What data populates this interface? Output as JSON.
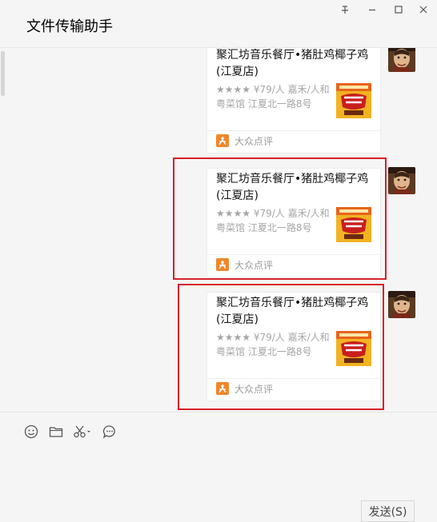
{
  "window": {
    "title": "文件传输助手",
    "controls": [
      "pin-icon",
      "minimize-icon",
      "maximize-icon",
      "close-icon"
    ]
  },
  "messages": [
    {
      "title": "聚汇坊音乐餐厅•猪肚鸡椰子鸡(江夏店)",
      "rating_stars": "★★★★",
      "desc": " ¥79/人 嘉禾/人和 粤菜馆 江夏北一路8号",
      "source": "大众点评",
      "highlighted": false
    },
    {
      "title": "聚汇坊音乐餐厅•猪肚鸡椰子鸡(江夏店)",
      "rating_stars": "★★★★",
      "desc": " ¥79/人 嘉禾/人和 粤菜馆 江夏北一路8号",
      "source": "大众点评",
      "highlighted": true
    },
    {
      "title": "聚汇坊音乐餐厅•猪肚鸡椰子鸡(江夏店)",
      "rating_stars": "★★★★",
      "desc": " ¥79/人 嘉禾/人和 粤菜馆 江夏北一路8号",
      "source": "大众点评",
      "highlighted": true
    }
  ],
  "toolbar": {
    "icons": [
      "emoji-icon",
      "folder-icon",
      "scissors-icon",
      "chat-history-icon"
    ]
  },
  "send_button": "发送(S)",
  "colors": {
    "background": "#f5f5f5",
    "highlight_border": "#d9212a",
    "dianping_orange": "#f0862a"
  }
}
